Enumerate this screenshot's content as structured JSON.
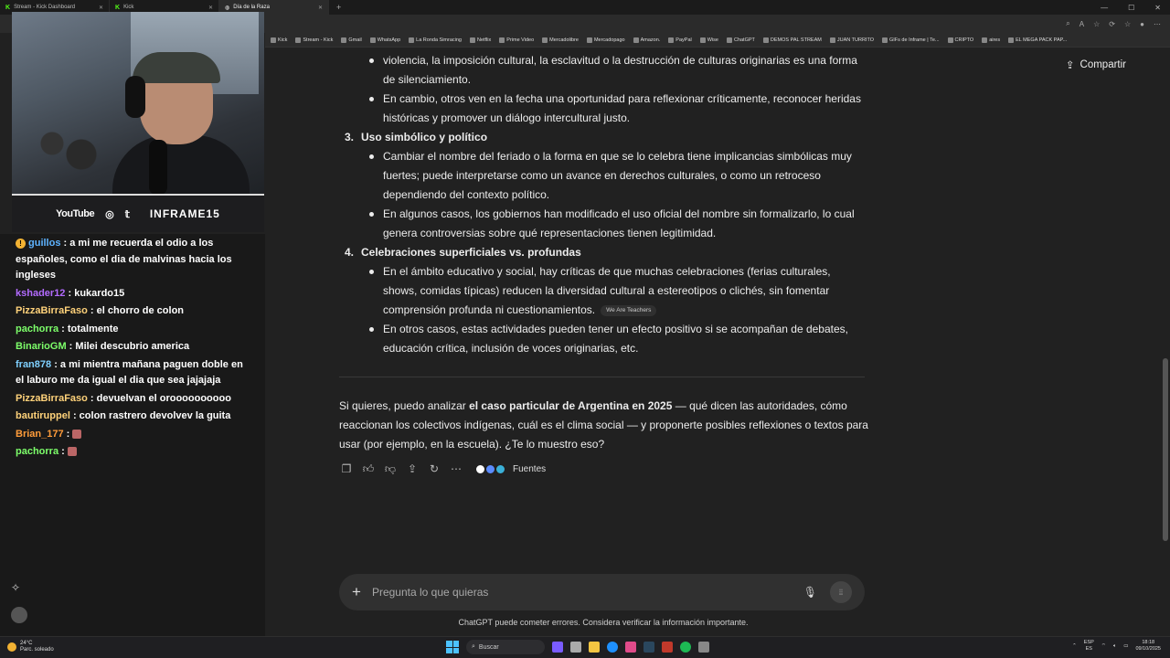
{
  "browser": {
    "tabs": [
      {
        "label": "Stream - Kick Dashboard"
      },
      {
        "label": "Kick"
      },
      {
        "label": "Día de la Raza"
      }
    ],
    "new_tab": "+",
    "bookmarks": [
      "Kick",
      "Stream - Kick",
      "Gmail",
      "WhatsApp",
      "La Ronda Simracing",
      "Netflix",
      "Prime Video",
      "Mercadolibre",
      "Mercadopago",
      "Amazon.",
      "PayPal",
      "Wise",
      "ChatGPT",
      "DEMOS PAL STREAM",
      "JUAN TURRITO",
      "GIFs de Inframe | Te...",
      "CRIPTO",
      "aires",
      "EL MEGA PACK PAP..."
    ]
  },
  "stream": {
    "socials": {
      "youtube": "YouTube",
      "handle": "INFRAME15"
    },
    "chat": [
      {
        "user": "guillos",
        "color": "#5eb3ff",
        "text": "a mi me recuerda el odio a los españoles, como el dia de malvinas hacia los ingleses",
        "badge": "!"
      },
      {
        "user": "kshader12",
        "color": "#b36bff",
        "text": "kukardo15"
      },
      {
        "user": "PizzaBirraFaso",
        "color": "#ffd27a",
        "text": "el chorro de colon"
      },
      {
        "user": "pachorra",
        "color": "#7dff6a",
        "text": "totalmente"
      },
      {
        "user": "BinarioGM",
        "color": "#7dff6a",
        "text": "Milei descubrio america"
      },
      {
        "user": "fran878",
        "color": "#7fd0ff",
        "text": "a mi mientra mañana paguen doble en el laburo me da igual el dia que sea jajajaja"
      },
      {
        "user": "PizzaBirraFaso",
        "color": "#ffd27a",
        "text": "devuelvan el oroooooooooo"
      },
      {
        "user": "bautiruppel",
        "color": "#ffd27a",
        "text": "colon rastrero devolvev la guita"
      },
      {
        "user": "Brian_177",
        "color": "#ff9c3a",
        "text": ""
      },
      {
        "user": "pachorra",
        "color": "#7dff6a",
        "text": ""
      }
    ]
  },
  "chatgpt": {
    "share_label": "Compartir",
    "intro_lines": "violencia, la imposición cultural, la esclavitud o la destrucción de culturas originarias es una forma de silenciamiento.",
    "intro_bullet": "En cambio, otros ven en la fecha una oportunidad para reflexionar críticamente, reconocer heridas históricas y promover un diálogo intercultural justo.",
    "sections": [
      {
        "num": "3.",
        "title": "Uso simbólico y político",
        "bullets": [
          "Cambiar el nombre del feriado o la forma en que se lo celebra tiene implicancias simbólicas muy fuertes; puede interpretarse como un avance en derechos culturales, o como un retroceso dependiendo del contexto político.",
          "En algunos casos, los gobiernos han modificado el uso oficial del nombre sin formalizarlo, lo cual genera controversias sobre qué representaciones tienen legitimidad."
        ]
      },
      {
        "num": "4.",
        "title": "Celebraciones superficiales vs. profundas",
        "bullets": [
          "En el ámbito educativo y social, hay críticas de que muchas celebraciones (ferias culturales, shows, comidas típicas) reducen la diversidad cultural a estereotipos o clichés, sin fomentar comprensión profunda ni cuestionamientos.",
          "En otros casos, estas actividades pueden tener un efecto positivo si se acompañan de debates, educación crítica, inclusión de voces originarias, etc."
        ],
        "citation": "We Are Teachers"
      }
    ],
    "closing": {
      "pre": "Si quieres, puedo analizar ",
      "bold": "el caso particular de Argentina en 2025",
      "post": " — qué dicen las autoridades, cómo reaccionan los colectivos indígenas, cuál es el clima social — y proponerte posibles reflexiones o textos para usar (por ejemplo, en la escuela). ¿Te lo muestro eso?"
    },
    "sources_label": "Fuentes",
    "composer_placeholder": "Pregunta lo que quieras",
    "disclaimer": "ChatGPT puede cometer errores. Considera verificar la información importante."
  },
  "taskbar": {
    "weather_temp": "24°C",
    "weather_desc": "Parc. soleado",
    "search_label": "Buscar",
    "lang1": "ESP",
    "lang2": "ES",
    "time": "18:18",
    "date": "09/10/2025"
  }
}
